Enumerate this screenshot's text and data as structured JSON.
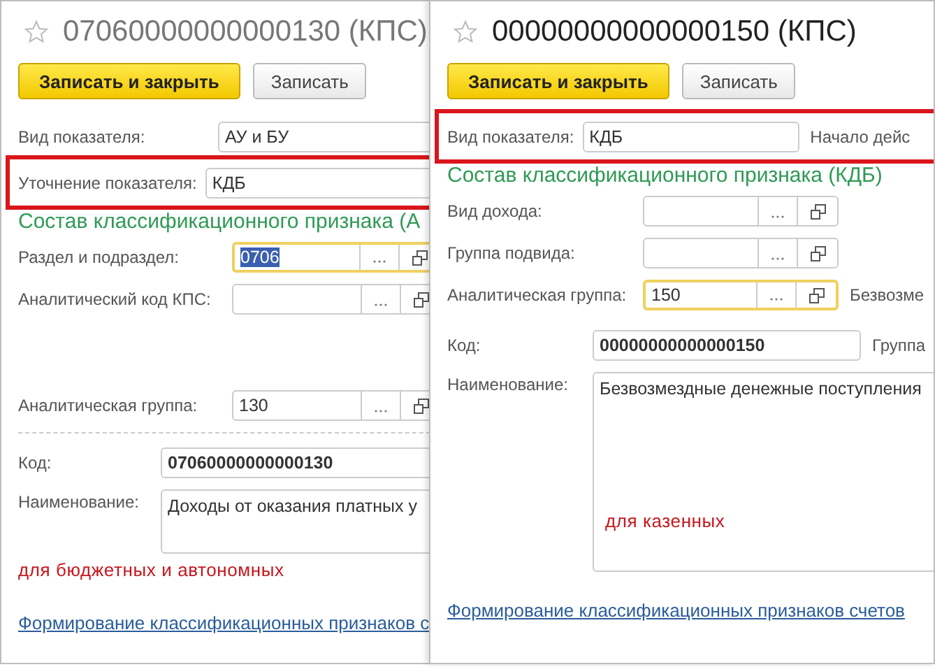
{
  "windows": [
    {
      "title": "07060000000000130 (КПС)",
      "active": false,
      "buttons": [
        {
          "label": "Записать и закрыть",
          "default": true
        },
        {
          "label": "Записать",
          "default": false
        }
      ],
      "header_fields": [
        {
          "label": "Вид показателя:",
          "value": "АУ и БУ",
          "highlighted": false
        },
        {
          "label": "Уточнение показателя:",
          "value": "КДБ",
          "highlighted": true
        }
      ],
      "section_title": "Состав классификационного признака (А",
      "section_fields": [
        {
          "kind": "field",
          "label": "Раздел и подраздел:",
          "value": "0706",
          "focused": true,
          "text_selected": true
        },
        {
          "kind": "field",
          "label": "Аналитический код КПС:",
          "focused": false
        },
        {
          "kind": "spacer"
        },
        {
          "kind": "field",
          "label": "Аналитическая группа:",
          "value": "130",
          "focused": false
        }
      ],
      "dashed_divider": true,
      "code": {
        "label": "Код:",
        "value": "07060000000000130"
      },
      "name": {
        "label": "Наименование:",
        "value": "Доходы от оказания платных у"
      },
      "annotation": "для бюджетных и автономных",
      "link": "Формирование классификационных признаков с"
    },
    {
      "title": "00000000000000150 (КПС)",
      "active": true,
      "buttons": [
        {
          "label": "Записать и закрыть",
          "default": true
        },
        {
          "label": "Записать",
          "default": false
        }
      ],
      "header_fields": [
        {
          "label": "Вид показателя:",
          "value": "КДБ",
          "highlighted": true,
          "note": "Начало дейс"
        }
      ],
      "section_title": "Состав классификационного признака (КДБ)",
      "section_fields": [
        {
          "kind": "field",
          "label": "Вид дохода:",
          "focused": false
        },
        {
          "kind": "field",
          "label": "Группа подвида:",
          "focused": false
        },
        {
          "kind": "field",
          "label": "Аналитическая группа:",
          "value": "150",
          "focused": true,
          "note": "Безвозме"
        }
      ],
      "code": {
        "label": "Код:",
        "value": "00000000000000150",
        "note": "Группа"
      },
      "name": {
        "label": "Наименование:",
        "value": "Безвозмездные денежные поступления",
        "annotation": "для казенных"
      },
      "link": "Формирование классификационных признаков счетов"
    }
  ]
}
